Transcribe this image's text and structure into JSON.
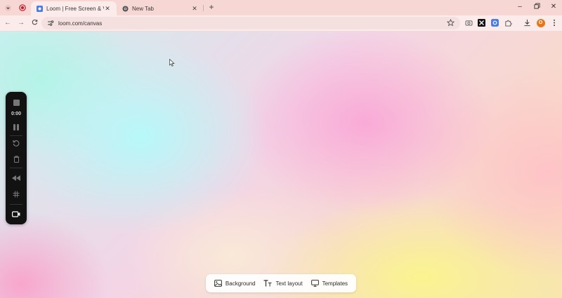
{
  "browser": {
    "tabs": [
      {
        "title": "Loom | Free Screen & Video Re",
        "active": true
      },
      {
        "title": "New Tab",
        "active": false
      }
    ],
    "url": "loom.com/canvas",
    "profile_initial": "O"
  },
  "recorder": {
    "timer": "0:00"
  },
  "bottom_toolbar": {
    "background_label": "Background",
    "text_layout_label": "Text layout",
    "templates_label": "Templates"
  },
  "colors": {
    "tab_strip": "#f7d7d3",
    "recorder_bg": "#121212",
    "profile_avatar": "#e8761c",
    "loom_blue": "#4b7be5"
  }
}
